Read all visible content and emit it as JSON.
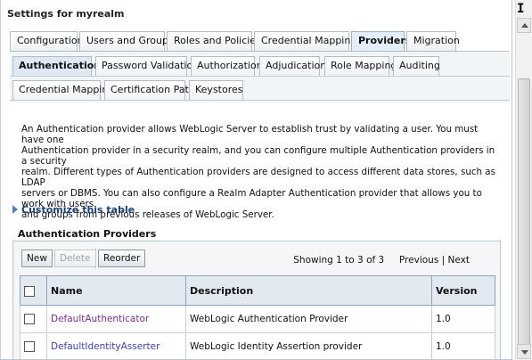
{
  "panel": {
    "title": "Settings for myrealm"
  },
  "main_tabs": [
    {
      "label": "Configuration"
    },
    {
      "label": "Users and Groups"
    },
    {
      "label": "Roles and Policies"
    },
    {
      "label": "Credential Mappings"
    },
    {
      "label": "Providers"
    },
    {
      "label": "Migration"
    }
  ],
  "sub_tabs_row1": [
    {
      "label": "Authentication"
    },
    {
      "label": "Password Validation"
    },
    {
      "label": "Authorization"
    },
    {
      "label": "Adjudication"
    },
    {
      "label": "Role Mapping"
    },
    {
      "label": "Auditing"
    }
  ],
  "sub_tabs_row2": [
    {
      "label": "Credential Mapping"
    },
    {
      "label": "Certification Path"
    },
    {
      "label": "Keystores"
    }
  ],
  "description": {
    "lines": [
      "An Authentication provider allows WebLogic Server to establish trust by validating a user. You must have one",
      "Authentication provider in a security realm, and you can configure multiple Authentication providers in a security",
      "realm. Different types of Authentication providers are designed to access different data stores, such as LDAP",
      "servers or DBMS. You can also configure a Realm Adapter Authentication provider that allows you to work with users",
      "and groups from previous releases of WebLogic Server."
    ]
  },
  "customize": {
    "label": "Customize this table"
  },
  "table_section": {
    "title": "Authentication Providers",
    "buttons": {
      "new": "New",
      "delete": "Delete",
      "reorder": "Reorder"
    },
    "pager": {
      "status": "Showing 1 to 3 of 3",
      "previous": "Previous",
      "separator": "|",
      "next": "Next"
    },
    "columns": [
      "Name",
      "Description",
      "Version"
    ],
    "rows": [
      {
        "name": "DefaultAuthenticator",
        "description": "WebLogic Authentication Provider",
        "version": "1.0"
      },
      {
        "name": "DefaultIdentityAsserter",
        "description": "WebLogic Identity Assertion provider",
        "version": "1.0"
      }
    ]
  },
  "cursor_glyph": "I"
}
